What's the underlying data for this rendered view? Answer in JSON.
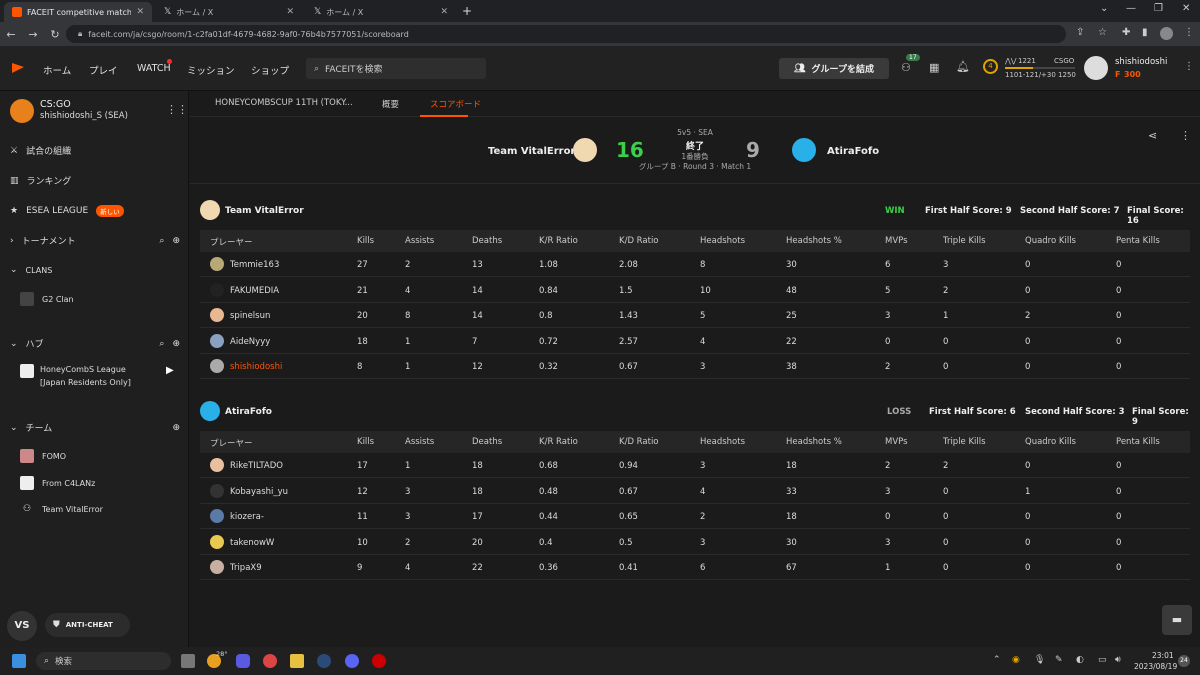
{
  "browser": {
    "tabs": [
      {
        "title": "FACEIT competitive match - FACEIT",
        "active": true
      },
      {
        "title": "ホーム / X",
        "active": false
      },
      {
        "title": "ホーム / X",
        "active": false
      }
    ],
    "url": "faceit.com/ja/csgo/room/1-c2fa01df-4679-4682-9af0-76b4b7577051/scoreboard"
  },
  "topbar": {
    "nav": [
      "ホーム",
      "プレイ",
      "WATCH",
      "ミッション",
      "ショップ"
    ],
    "search_placeholder": "FACEITを検索",
    "party_button": "グループを結成",
    "friends_badge": "17",
    "level": "4",
    "elo": "1221",
    "game": "CSGO",
    "elo_range": "1101-121/+30 1250",
    "username": "shishiodoshi",
    "points": "300"
  },
  "sidebar": {
    "game": "CS:GO",
    "account": "shishiodoshi_S (SEA)",
    "items": {
      "organize": "試合の組織",
      "ranking": "ランキング",
      "esea": "ESEA LEAGUE",
      "esea_badge": "新しい",
      "tournament": "トーナメント",
      "clans": "CLANS",
      "clan1": "G2 Clan",
      "hub": "ハブ",
      "hub1_line1": "HoneyCombS League",
      "hub1_line2": "[Japan Residents Only]",
      "team": "チーム",
      "team1": "FOMO",
      "team2": "From C4LANz",
      "team3": "Team VitalError"
    },
    "vs": "VS",
    "anticheat": "ANTI-CHEAT"
  },
  "subnav": {
    "tab1": "HONEYCOMBSCUP 11TH (TOKY...",
    "tab2": "概要",
    "tab3": "スコアボード"
  },
  "match": {
    "team1": "Team VitalError",
    "team2": "AtiraFofo",
    "score1": "16",
    "score2": "9",
    "format": "5v5 · SEA",
    "status": "終了",
    "bestof": "1番勝負",
    "group": "グループ B · Round 3 · Match 1"
  },
  "columns": [
    "プレーヤー",
    "Kills",
    "Assists",
    "Deaths",
    "K/R Ratio",
    "K/D Ratio",
    "Headshots",
    "Headshots %",
    "MVPs",
    "Triple Kills",
    "Quadro Kills",
    "Penta Kills"
  ],
  "teams": [
    {
      "name": "Team VitalError",
      "result": "WIN",
      "first_half": "First Half Score: 9",
      "second_half": "Second Half Score: 7",
      "final": "Final Score: 16",
      "players": [
        [
          "Temmie163",
          "27",
          "2",
          "13",
          "1.08",
          "2.08",
          "8",
          "30",
          "6",
          "3",
          "0",
          "0"
        ],
        [
          "FAKUMEDIA",
          "21",
          "4",
          "14",
          "0.84",
          "1.5",
          "10",
          "48",
          "5",
          "2",
          "0",
          "0"
        ],
        [
          "spinelsun",
          "20",
          "8",
          "14",
          "0.8",
          "1.43",
          "5",
          "25",
          "3",
          "1",
          "2",
          "0"
        ],
        [
          "AideNyyy",
          "18",
          "1",
          "7",
          "0.72",
          "2.57",
          "4",
          "22",
          "0",
          "0",
          "0",
          "0"
        ],
        [
          "shishiodoshi",
          "8",
          "1",
          "12",
          "0.32",
          "0.67",
          "3",
          "38",
          "2",
          "0",
          "0",
          "0"
        ]
      ]
    },
    {
      "name": "AtiraFofo",
      "result": "LOSS",
      "first_half": "First Half Score: 6",
      "second_half": "Second Half Score: 3",
      "final": "Final Score: 9",
      "players": [
        [
          "RikeTILTADO",
          "17",
          "1",
          "18",
          "0.68",
          "0.94",
          "3",
          "18",
          "2",
          "2",
          "0",
          "0"
        ],
        [
          "Kobayashi_yu",
          "12",
          "3",
          "18",
          "0.48",
          "0.67",
          "4",
          "33",
          "3",
          "0",
          "1",
          "0"
        ],
        [
          "kiozera-",
          "11",
          "3",
          "17",
          "0.44",
          "0.65",
          "2",
          "18",
          "0",
          "0",
          "0",
          "0"
        ],
        [
          "takenowW",
          "10",
          "2",
          "20",
          "0.4",
          "0.5",
          "3",
          "30",
          "3",
          "0",
          "0",
          "0"
        ],
        [
          "TripaX9",
          "9",
          "4",
          "22",
          "0.36",
          "0.41",
          "6",
          "67",
          "1",
          "0",
          "0",
          "0"
        ]
      ]
    }
  ],
  "highlight_player": "shishiodoshi",
  "colors": {
    "accent": "#ff5500",
    "win": "#3cd04a",
    "loss": "#aaaaaa"
  },
  "taskbar": {
    "search": "検索",
    "weather": "28°",
    "time": "23:01",
    "date": "2023/08/19",
    "notif": "24"
  }
}
